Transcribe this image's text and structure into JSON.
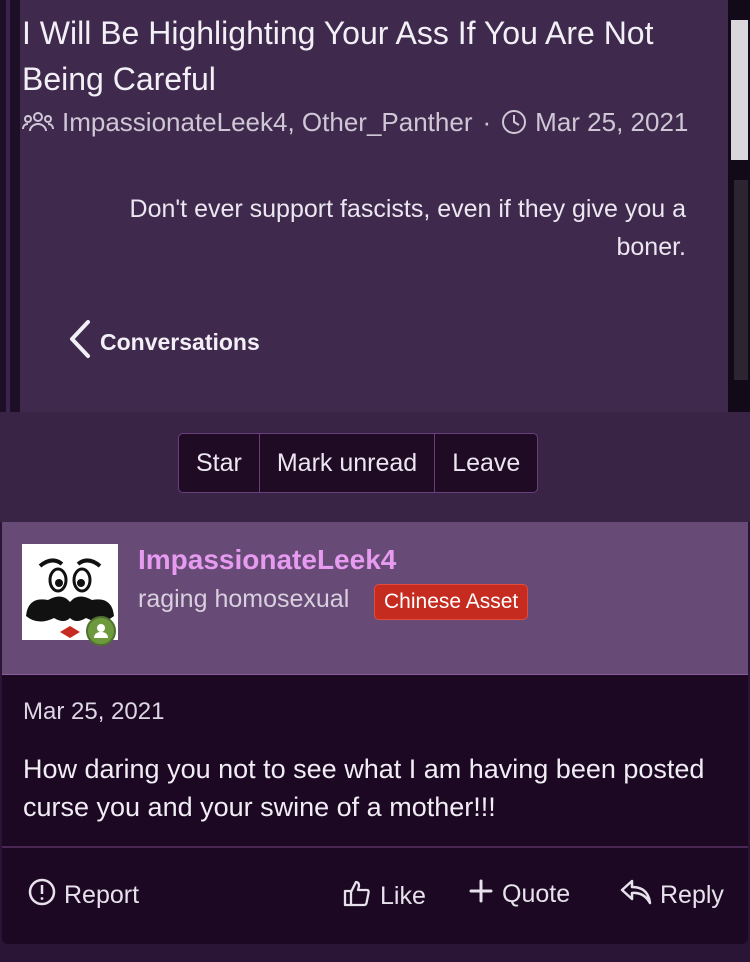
{
  "thread": {
    "title": "I Will Be Highlighting Your Ass If You Are Not Being Careful",
    "participants": "ImpassionateLeek4, Other_Panther",
    "separator": "·",
    "date": "Mar 25, 2021",
    "snippet": "Don't ever support fascists, even if they give you a boner.",
    "back_label": "Conversations"
  },
  "actions": {
    "star": "Star",
    "mark_unread": "Mark unread",
    "leave": "Leave"
  },
  "message": {
    "username": "ImpassionateLeek4",
    "user_title": "raging homosexual",
    "badge": "Chinese Asset",
    "date": "Mar 25, 2021",
    "body": "How daring you not to see what I am having been posted curse you and your swine of a mother!!!",
    "footer": {
      "report": "Report",
      "like": "Like",
      "quote": "Quote",
      "reply": "Reply"
    }
  },
  "colors": {
    "username": "#e79bf0",
    "badge_bg": "#c62b1f",
    "online": "#6e9a3e"
  }
}
